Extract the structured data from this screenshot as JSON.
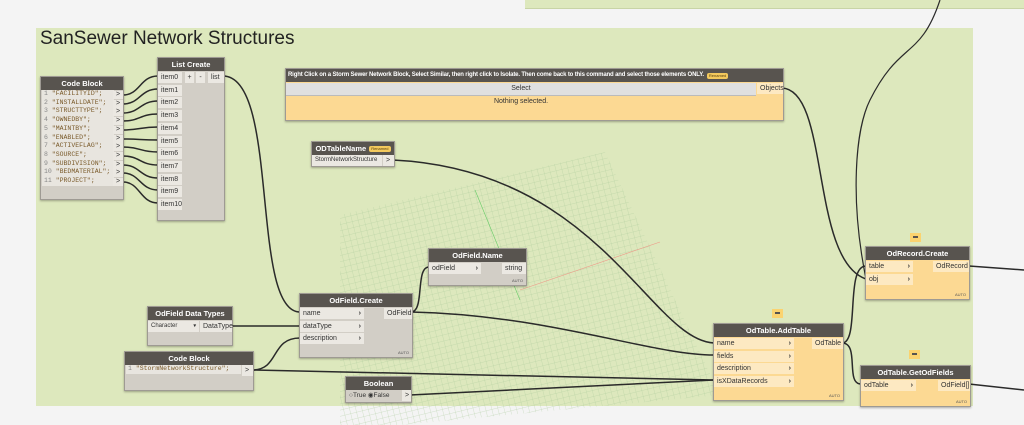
{
  "group": {
    "title": "SanSewer Network Structures"
  },
  "code_block_1": {
    "title": "Code Block",
    "lines": [
      "\"FACILITYID\";",
      "\"INSTALLDATE\";",
      "\"STRUCTTYPE\";",
      "\"OWNEDBY\";",
      "\"MAINTBY\";",
      "\"ENABLED\";",
      "\"ACTIVEFLAG\";",
      "\"SOURCE\";",
      "\"SUBDIVISION\";",
      "\"BEDMATERIAL\";",
      "\"PROJECT\";"
    ],
    "output": ">"
  },
  "list_create": {
    "title": "List Create",
    "inputs": [
      "item0",
      "item1",
      "item2",
      "item3",
      "item4",
      "item5",
      "item6",
      "item7",
      "item8",
      "item9",
      "item10"
    ],
    "add": "+",
    "remove": "-",
    "output": "list"
  },
  "select_node": {
    "title": "Right Click on a Storm Sewer Network Block, Select Similar, then right click to Isolate. Then come back to this command and select those elements ONLY.",
    "badge": "Renamed",
    "button": "Select",
    "output": "Objects",
    "status": "Nothing selected."
  },
  "odtablename": {
    "title": "ODTableName",
    "badge": "Renamed",
    "value": "StormNetworkStructure",
    "output": ">"
  },
  "odfield_name": {
    "title": "OdField.Name",
    "input": "odField",
    "output": "string",
    "lacing": "AUTO"
  },
  "odfield_datatypes": {
    "title": "OdField Data Types",
    "selected": "Character",
    "output": "DataType"
  },
  "odfield_create": {
    "title": "OdField.Create",
    "inputs": [
      "name",
      "dataType",
      "description"
    ],
    "output": "OdField",
    "lacing": "AUTO"
  },
  "code_block_2": {
    "title": "Code Block",
    "line_no": "1",
    "line": "\"StormNetworkStructure\";",
    "output": ">"
  },
  "boolean": {
    "title": "Boolean",
    "true_label": "True",
    "false_label": "False",
    "value": false,
    "output": ">"
  },
  "addtable": {
    "title": "OdTable.AddTable",
    "inputs": [
      "name",
      "fields",
      "description",
      "isXDataRecords"
    ],
    "output": "OdTable",
    "lacing": "AUTO"
  },
  "odrecord_create": {
    "title": "OdRecord.Create",
    "inputs": [
      "table",
      "obj"
    ],
    "output": "OdRecord",
    "lacing": "AUTO"
  },
  "getodfields": {
    "title": "OdTable.GetOdFields",
    "input": "odTable",
    "output": "OdField[]",
    "lacing": "AUTO"
  }
}
